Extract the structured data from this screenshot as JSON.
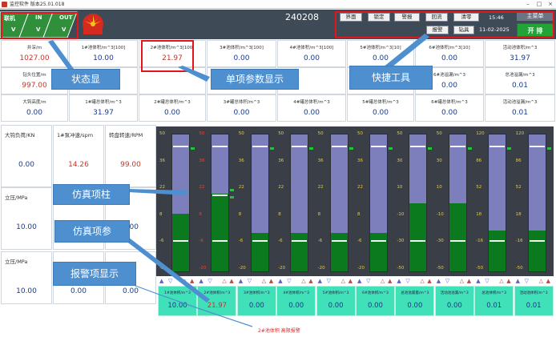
{
  "window": {
    "title": "监控软件 版本25.01.018"
  },
  "header": {
    "status_tiles": [
      {
        "label": "联机",
        "value": "V"
      },
      {
        "label": "IN",
        "value": "V"
      },
      {
        "label": "OUT",
        "value": "V"
      }
    ],
    "serial": "240208",
    "buttons_row1": [
      "界面",
      "锁定",
      "警报",
      "回流",
      "清零"
    ],
    "buttons_row2": [
      "报警",
      "钻具"
    ],
    "time": "15:46",
    "date": "11-02-2025",
    "main_menu": "主菜单",
    "start": "开 排"
  },
  "params": {
    "row1": [
      {
        "label": "井深/m",
        "value": "1027.00",
        "red": true
      },
      {
        "label": "1#池体积/m^3[100]",
        "value": "10.00"
      },
      {
        "label": "2#池体积/m^3[100]",
        "value": "21.97",
        "red": true
      },
      {
        "label": "3#池体积/m^3[100]",
        "value": "0.00"
      },
      {
        "label": "4#池体积/m^3[100]",
        "value": "0.00"
      },
      {
        "label": "5#池体积/m^3[10]",
        "value": "0.00"
      },
      {
        "label": "6#池体积/m^3[10]",
        "value": "0.00"
      },
      {
        "label": "活动池体积/m^3",
        "value": "31.97"
      }
    ],
    "row2": [
      {
        "label": "钻头位置/m",
        "value": "997.00",
        "red": true
      },
      {
        "label": "",
        "value": ""
      },
      {
        "label": "",
        "value": ""
      },
      {
        "label": "3#池溢漏/m^3",
        "value": "0.00"
      },
      {
        "label": "",
        "value": ""
      },
      {
        "label": "",
        "value": ""
      },
      {
        "label": "6#池溢漏/m^3",
        "value": "0.00"
      },
      {
        "label": "总池溢漏/m^3",
        "value": "0.01"
      }
    ],
    "row3": [
      {
        "label": "大钩高度/m",
        "value": "0.00"
      },
      {
        "label": "1#罐总体积/m^3",
        "value": "31.97"
      },
      {
        "label": "2#罐总体积/m^3",
        "value": "0.00"
      },
      {
        "label": "3#罐总体积/m^3",
        "value": "0.00"
      },
      {
        "label": "4#罐总体积/m^3",
        "value": "0.00"
      },
      {
        "label": "5#罐总体积/m^3",
        "value": "0.00"
      },
      {
        "label": "6#罐总体积/m^3",
        "value": "0.00"
      },
      {
        "label": "活动池溢漏/m^3",
        "value": "0.01"
      }
    ]
  },
  "left_panel": [
    {
      "label": "大钩负荷/KN",
      "value": "0.00"
    },
    {
      "label": "1#泵冲速/spm",
      "value": "14.26",
      "red": true
    },
    {
      "label": "转盘转速/RPM",
      "value": "99.00",
      "red": true
    },
    {
      "label": "立压/MPa",
      "value": "10.00"
    },
    {
      "label": "",
      "value": ""
    },
    {
      "label": "速/mS",
      "value": "0.00"
    },
    {
      "label": "立压/MPa",
      "value": "10.00"
    },
    {
      "label": "",
      "value": "0.00"
    },
    {
      "label": "",
      "value": "0.00"
    }
  ],
  "tanks": [
    {
      "ticks": [
        "50",
        "36",
        "22",
        "8",
        "-6",
        "-20"
      ],
      "red": false,
      "level": 0.42,
      "marks": [
        0.92,
        0.23
      ],
      "green": 0.9,
      "label": "1#池体积/m^3",
      "value": "10.00",
      "red_value": false
    },
    {
      "ticks": [
        "50",
        "36",
        "22",
        "8",
        "-6",
        "-20"
      ],
      "red": true,
      "level": 0.57,
      "marks": [
        0.92,
        0.56,
        0.23
      ],
      "green": 0.6,
      "label": "2#池体积/m^3",
      "value": "21.97",
      "red_value": true
    },
    {
      "ticks": [
        "50",
        "36",
        "22",
        "8",
        "-6",
        "-20"
      ],
      "red": false,
      "level": 0.28,
      "marks": [
        0.92,
        0.23
      ],
      "green": 0.9,
      "label": "3#池体积/m^3",
      "value": "0.00",
      "red_value": false
    },
    {
      "ticks": [
        "50",
        "36",
        "22",
        "8",
        "-6",
        "-20"
      ],
      "red": false,
      "level": 0.28,
      "marks": [
        0.92,
        0.23
      ],
      "green": 0.9,
      "label": "4#池体积/m^3",
      "value": "0.00",
      "red_value": false
    },
    {
      "ticks": [
        "50",
        "36",
        "22",
        "8",
        "-6",
        "-20"
      ],
      "red": false,
      "level": 0.28,
      "marks": [
        0.92,
        0.23
      ],
      "green": 0.9,
      "label": "5#池体积/m^3",
      "value": "0.00",
      "red_value": false
    },
    {
      "ticks": [
        "50",
        "36",
        "22",
        "8",
        "-6",
        "-20"
      ],
      "red": false,
      "level": 0.28,
      "marks": [
        0.92,
        0.23
      ],
      "green": 0.9,
      "label": "6#池体积/m^3",
      "value": "0.00",
      "red_value": false
    },
    {
      "ticks": [
        "50",
        "30",
        "10",
        "-10",
        "-30",
        "-50"
      ],
      "red": false,
      "level": 0.5,
      "marks": [
        0.92,
        0.23
      ],
      "green": 0.9,
      "label": "总池溢漏量/m^3",
      "value": "0.00",
      "red_value": false
    },
    {
      "ticks": [
        "50",
        "30",
        "10",
        "-10",
        "-30",
        "-50"
      ],
      "red": false,
      "level": 0.5,
      "marks": [
        0.92,
        0.23
      ],
      "green": 0.9,
      "label": "活动池溢漏/m^3",
      "value": "0.00",
      "red_value": false
    },
    {
      "ticks": [
        "120",
        "86",
        "52",
        "18",
        "-16",
        "-50"
      ],
      "red": false,
      "level": 0.3,
      "marks": [
        0.92,
        0.23
      ],
      "green": 0.9,
      "label": "总池体积/m^3",
      "value": "0.01",
      "red_value": false
    },
    {
      "ticks": [
        "120",
        "86",
        "52",
        "18",
        "-16",
        "-50"
      ],
      "red": false,
      "level": 0.3,
      "marks": [
        0.92,
        0.23
      ],
      "green": 0.9,
      "label": "活动池体积/m^3",
      "value": "0.01",
      "red_value": false
    }
  ],
  "annotations": {
    "status": "状态显",
    "single_param": "单项参数显示",
    "quick_tools": "快捷工具",
    "sim_column": "仿真项柱",
    "sim_param": "仿真项参",
    "alarm_display": "报警项显示"
  },
  "alarm_text": "2#池体积 高限报警",
  "colors": {
    "header_bg": "#3f4a57",
    "tank_fill": "#0b7a1e",
    "tank_empty": "#7d7fbd",
    "gauge_bg": "#40e0b8",
    "annotation": "#4e8fd0",
    "highlight": "#e5141a"
  }
}
